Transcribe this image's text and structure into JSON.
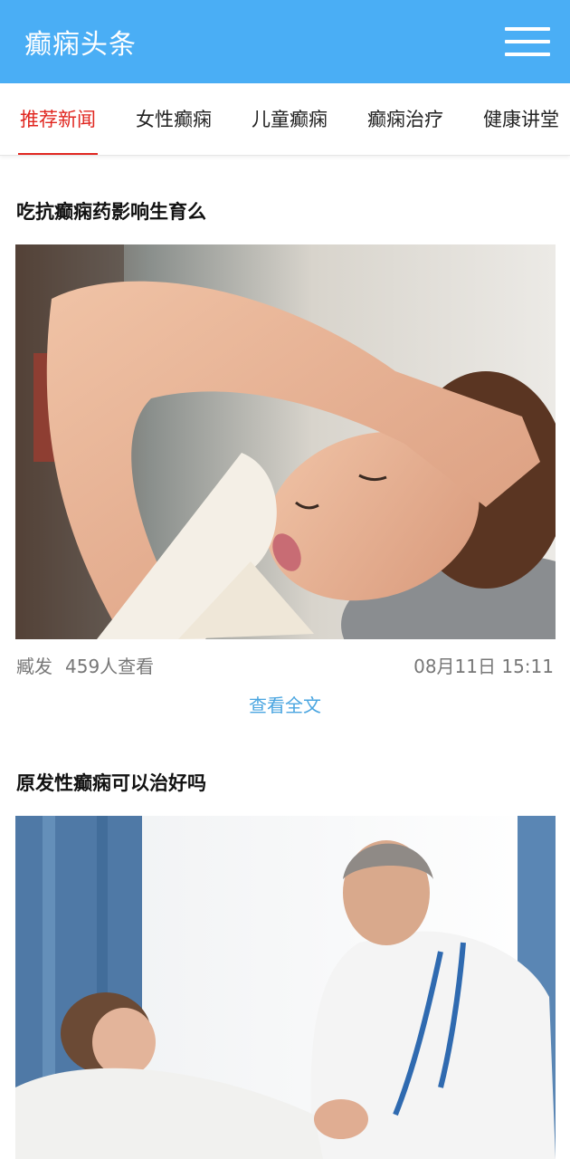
{
  "header": {
    "title": "癫痫头条",
    "menu_icon": "hamburger-menu-icon"
  },
  "tabs": [
    {
      "label": "推荐新闻",
      "active": true
    },
    {
      "label": "女性癫痫",
      "active": false
    },
    {
      "label": "儿童癫痫",
      "active": false
    },
    {
      "label": "癫痫治疗",
      "active": false
    },
    {
      "label": "健康讲堂",
      "active": false
    }
  ],
  "articles": [
    {
      "title": "吃抗癫痫药影响生育么",
      "image": "photo-woman-headache",
      "source": "臧发",
      "views": "459人查看",
      "date": "08月11日 15:11",
      "read_more": "查看全文"
    },
    {
      "title": "原发性癫痫可以治好吗",
      "image": "photo-doctor-patient-bedside"
    }
  ],
  "colors": {
    "header_bg": "#4aaef5",
    "active_tab": "#e0261f",
    "link": "#4aa5e0"
  }
}
